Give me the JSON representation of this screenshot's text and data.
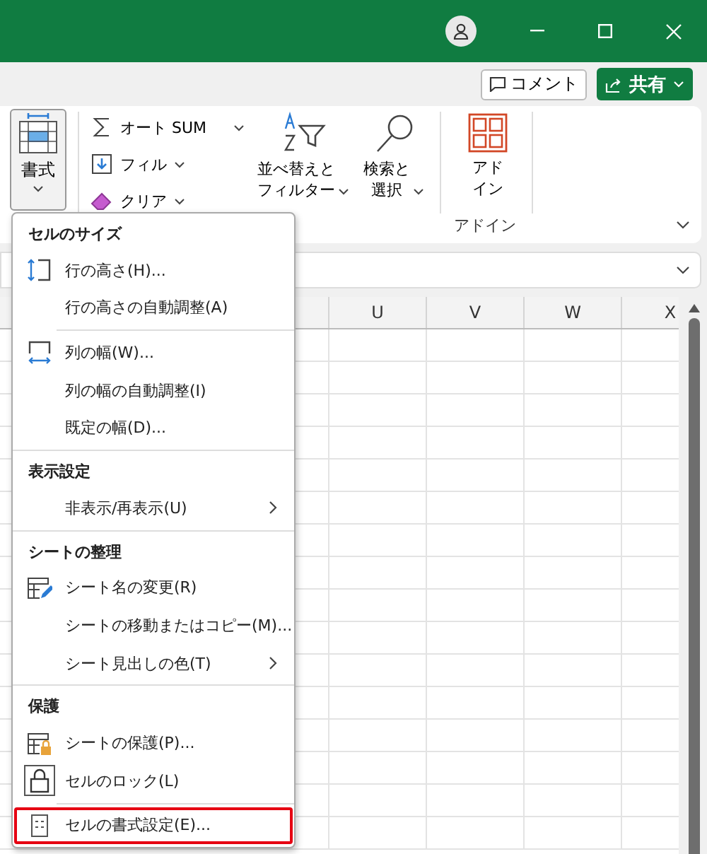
{
  "toolbar": {
    "comment_button": "コメント",
    "share_button": "共有"
  },
  "ribbon": {
    "format_button": {
      "label": "書式",
      "selected": true
    },
    "editing": {
      "small_buttons": [
        {
          "label": "オート SUM",
          "kind": "sum"
        },
        {
          "label": "フィル",
          "kind": "fill"
        },
        {
          "label": "クリア",
          "kind": "clear"
        }
      ],
      "big_buttons": [
        {
          "lines": [
            "並べ替えと",
            "フィルター"
          ],
          "kind": "sort"
        },
        {
          "lines": [
            "検索と",
            "選択"
          ],
          "kind": "find"
        }
      ]
    },
    "addin": {
      "button_lines": [
        "アド",
        "イン"
      ],
      "group_label": "アドイン"
    }
  },
  "sheet": {
    "columns": [
      "",
      "",
      "",
      "",
      "U",
      "V",
      "W",
      "X"
    ]
  },
  "menu": {
    "entries": [
      {
        "kind": "header",
        "label": "セルのサイズ"
      },
      {
        "kind": "item",
        "label": "行の高さ(H)...",
        "has_submenu": false,
        "checked": false,
        "highlighted": false
      },
      {
        "kind": "item",
        "label": "行の高さの自動調整(A)",
        "has_submenu": false,
        "checked": false,
        "highlighted": false
      },
      {
        "kind": "subseparator"
      },
      {
        "kind": "item",
        "label": "列の幅(W)...",
        "has_submenu": false,
        "checked": false,
        "highlighted": false
      },
      {
        "kind": "item",
        "label": "列の幅の自動調整(I)",
        "has_submenu": false,
        "checked": false,
        "highlighted": false
      },
      {
        "kind": "item",
        "label": "既定の幅(D)...",
        "has_submenu": false,
        "checked": false,
        "highlighted": false
      },
      {
        "kind": "separator"
      },
      {
        "kind": "header",
        "label": "表示設定"
      },
      {
        "kind": "item",
        "label": "非表示/再表示(U)",
        "has_submenu": true,
        "checked": false,
        "highlighted": false
      },
      {
        "kind": "separator"
      },
      {
        "kind": "header",
        "label": "シートの整理"
      },
      {
        "kind": "item",
        "label": "シート名の変更(R)",
        "has_submenu": false,
        "checked": false,
        "highlighted": false
      },
      {
        "kind": "item",
        "label": "シートの移動またはコピー(M)...",
        "has_submenu": false,
        "checked": false,
        "highlighted": false
      },
      {
        "kind": "item",
        "label": "シート見出しの色(T)",
        "has_submenu": true,
        "checked": false,
        "highlighted": false
      },
      {
        "kind": "separator"
      },
      {
        "kind": "header",
        "label": "保護"
      },
      {
        "kind": "item",
        "label": "シートの保護(P)...",
        "has_submenu": false,
        "checked": false,
        "highlighted": false
      },
      {
        "kind": "item",
        "label": "セルのロック(L)",
        "has_submenu": false,
        "checked": true,
        "highlighted": false
      },
      {
        "kind": "subseparator"
      },
      {
        "kind": "item",
        "label": "セルの書式設定(E)...",
        "has_submenu": false,
        "checked": false,
        "highlighted": true
      }
    ]
  }
}
